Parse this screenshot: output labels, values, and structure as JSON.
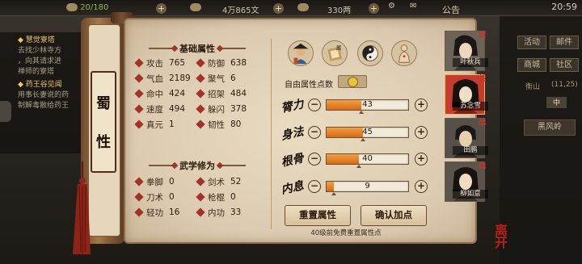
{
  "topbar": {
    "stamina": "20/180",
    "money": "4万865文",
    "silver": "330两",
    "announcement": "公告",
    "time": "20:59"
  },
  "quests": {
    "q1_title": "◆ 慧觉寮塔",
    "q1_lines": [
      "去找少林寺方",
      "，向其请求进",
      "禅师的寮塔"
    ],
    "q2_title": "◆ 药王谷见闻",
    "q2_lines": [
      "用事长妻说的药",
      "制解毒散给药王"
    ]
  },
  "right_menu": {
    "row1": [
      "活动",
      "邮件"
    ],
    "row2": [
      "商城",
      "社区"
    ],
    "location": "衡山",
    "coords": "(11,25)",
    "dir": "中",
    "map_name": "黑风岭"
  },
  "scroll": {
    "school_char1": "蜀",
    "school_char2": "性"
  },
  "basic_attrs": {
    "title": "基础属性",
    "items": [
      {
        "label": "攻击",
        "value": "765"
      },
      {
        "label": "防御",
        "value": "638"
      },
      {
        "label": "气血",
        "value": "2189"
      },
      {
        "label": "聚气",
        "value": "6"
      },
      {
        "label": "命中",
        "value": "424"
      },
      {
        "label": "招架",
        "value": "484"
      },
      {
        "label": "速度",
        "value": "494"
      },
      {
        "label": "躲闪",
        "value": "378"
      },
      {
        "label": "真元",
        "value": "1"
      },
      {
        "label": "韧性",
        "value": "80"
      }
    ]
  },
  "martial": {
    "title": "武学修为",
    "items": [
      {
        "label": "拳脚",
        "value": "0"
      },
      {
        "label": "剑术",
        "value": "52"
      },
      {
        "label": "刀术",
        "value": "0"
      },
      {
        "label": "枪棍",
        "value": "0"
      },
      {
        "label": "轻功",
        "value": "16"
      },
      {
        "label": "内功",
        "value": "33"
      }
    ]
  },
  "stats": {
    "free_points_label": "自由属性点数",
    "rows": [
      {
        "label": "膂力",
        "value": "43",
        "fraction": 0.43
      },
      {
        "label": "身法",
        "value": "45",
        "fraction": 0.45
      },
      {
        "label": "根骨",
        "value": "40",
        "fraction": 0.4
      },
      {
        "label": "内息",
        "value": "9",
        "fraction": 0.09
      }
    ],
    "minus": "−",
    "plus": "+"
  },
  "buttons": {
    "reset": "重置属性",
    "confirm": "确认加点",
    "note": "40级前免费重置属性点"
  },
  "characters": [
    {
      "name": "叶秋兵",
      "tag": "战",
      "active": false
    },
    {
      "name": "苏念雪",
      "tag": "战",
      "active": true
    },
    {
      "name": "田鹏",
      "tag": "战",
      "active": false
    },
    {
      "name": "柳如意",
      "tag": "战",
      "active": false
    }
  ],
  "corner_seal": "离开",
  "colors": {
    "accent_red": "#a3332a",
    "bar_fill": "#e0802a",
    "parchment": "#e6d8bd"
  }
}
